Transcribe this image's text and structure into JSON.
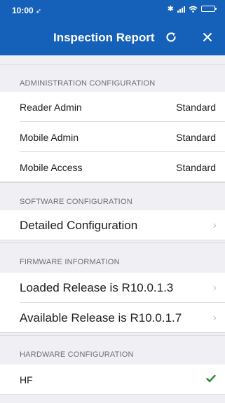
{
  "status_bar": {
    "time": "10:00",
    "location_glyph": "➶",
    "bluetooth_glyph": "✱"
  },
  "nav": {
    "title": "Inspection Report",
    "refresh_icon": "refresh-icon",
    "close_icon": "close-icon"
  },
  "sections": {
    "admin": {
      "header": "ADMINISTRATION CONFIGURATION",
      "rows": [
        {
          "label": "Reader Admin",
          "value": "Standard"
        },
        {
          "label": "Mobile Admin",
          "value": "Standard"
        },
        {
          "label": "Mobile Access",
          "value": "Standard"
        }
      ]
    },
    "software": {
      "header": "SOFTWARE CONFIGURATION",
      "rows": [
        {
          "label": "Detailed Configuration",
          "chevron": "›"
        }
      ]
    },
    "firmware": {
      "header": "FIRMWARE INFORMATION",
      "rows": [
        {
          "label": "Loaded Release is R10.0.1.3",
          "chevron": "›"
        },
        {
          "label": "Available Release is R10.0.1.7",
          "chevron": "›"
        }
      ]
    },
    "hardware": {
      "header": "HARDWARE CONFIGURATION",
      "rows": [
        {
          "label": "HF",
          "status_icon": "checkmark-icon"
        }
      ]
    }
  },
  "colors": {
    "nav_background": "#1560b8",
    "page_background": "#efeff4",
    "check_color": "#2e8b2e"
  }
}
